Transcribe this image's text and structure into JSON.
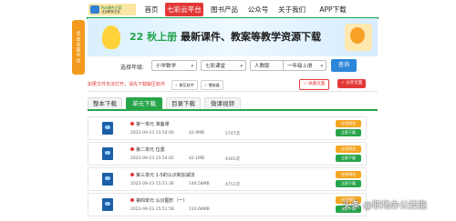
{
  "side_badge": {
    "text": "点击全部平台"
  },
  "logo": {
    "line1": "Ppt课件之家",
    "line2": "北京教育文化"
  },
  "nav": {
    "items": [
      {
        "label": "首页",
        "active": false
      },
      {
        "label": "七彩云平台",
        "active": true
      },
      {
        "label": "图书产品",
        "active": false
      },
      {
        "label": "公众号",
        "active": false
      },
      {
        "label": "关于我们",
        "active": false
      },
      {
        "label": "APP下载",
        "active": false
      }
    ]
  },
  "banner": {
    "grade_tag": "22 秋上册",
    "title": "最新课件、教案等教学资源下载"
  },
  "selector": {
    "label": "选择年级:",
    "options": [
      "小学数学",
      "七彩课堂",
      "人教版",
      "一年级上册"
    ],
    "query_button": "查询"
  },
  "hint": {
    "text": "如果文件无法打开，请先下载解压软件",
    "mini_buttons": [
      "✓ 解压软件",
      "✓ 播放器"
    ],
    "right_buttons": [
      {
        "label": "✓ 收藏页面",
        "color": "#e23838"
      },
      {
        "label": "✓ 分享页面",
        "color": "#e23838"
      }
    ]
  },
  "tabs": [
    {
      "label": "整本下载",
      "active": false
    },
    {
      "label": "单元下载",
      "active": true
    },
    {
      "label": "目录下载",
      "active": false
    },
    {
      "label": "微课视频",
      "active": false
    }
  ],
  "files": [
    {
      "title": "第一单元 准备课",
      "date": "2022-09-23 15:54:00",
      "size": "42.9MB",
      "downloads": "5747次",
      "view": "在线预览",
      "download": "立即下载"
    },
    {
      "title": "第二单元 位置",
      "date": "2022-09-23 15:54:02",
      "size": "42.1MB",
      "downloads": "4301次",
      "view": "在线预览",
      "download": "立即下载"
    },
    {
      "title": "第三单元 1-5的认识和加减法",
      "date": "2022-09-23 15:51:36",
      "size": "146.58MB",
      "downloads": "4751次",
      "view": "在线预览",
      "download": "立即下载"
    },
    {
      "title": "第四单元 认识图形（一）",
      "date": "2022-09-23 15:51:58",
      "size": "110.68MB",
      "downloads": "",
      "view": "在线预览",
      "download": "立即下载"
    }
  ],
  "watermark": {
    "text": "头条 @职场办公技能"
  },
  "colors": {
    "accent_green": "#27a54a",
    "accent_red": "#e23838",
    "accent_orange": "#f5a623",
    "query_blue": "#2d86d8"
  }
}
